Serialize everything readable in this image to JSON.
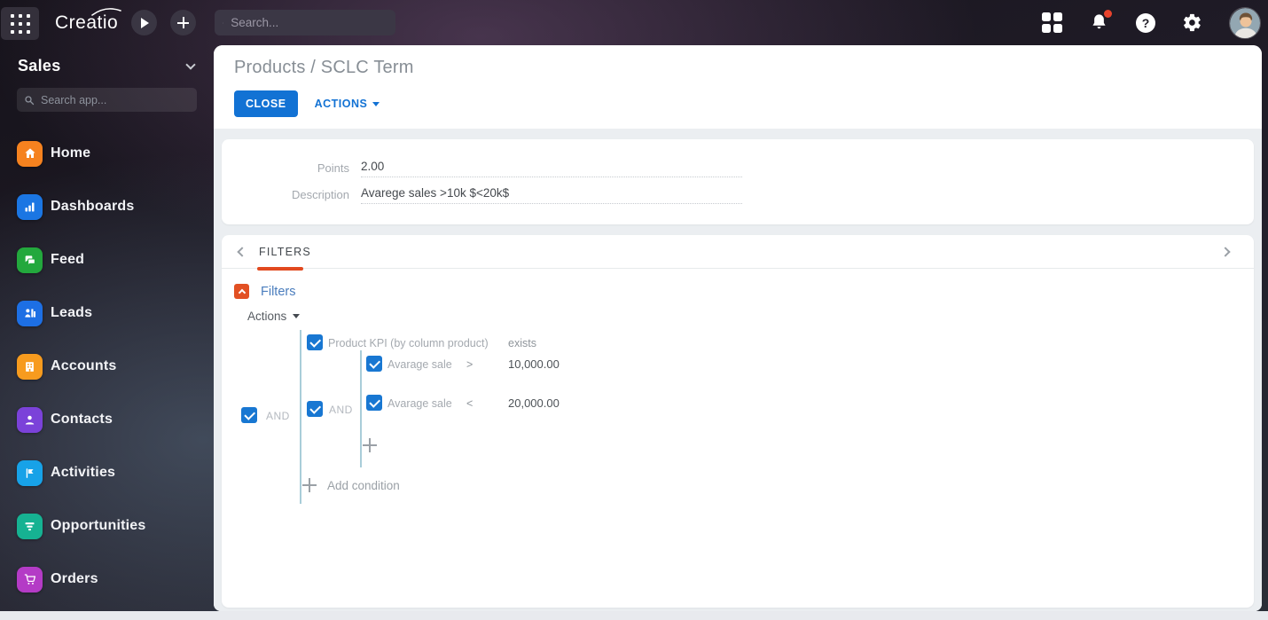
{
  "topbar": {
    "logo": "Creatio",
    "search_placeholder": "Search..."
  },
  "sidebar": {
    "workspace": "Sales",
    "search_placeholder": "Search app...",
    "items": [
      {
        "label": "Home",
        "icon": "home-icon",
        "color": "#f5821f"
      },
      {
        "label": "Dashboards",
        "icon": "bar-chart-icon",
        "color": "#1b76e3"
      },
      {
        "label": "Feed",
        "icon": "chat-bubbles-icon",
        "color": "#23a83d"
      },
      {
        "label": "Leads",
        "icon": "leads-icon",
        "color": "#1d6fe4"
      },
      {
        "label": "Accounts",
        "icon": "building-icon",
        "color": "#f79b1e"
      },
      {
        "label": "Contacts",
        "icon": "person-icon",
        "color": "#7b42d9"
      },
      {
        "label": "Activities",
        "icon": "flag-icon",
        "color": "#17a2e8"
      },
      {
        "label": "Opportunities",
        "icon": "funnel-icon",
        "color": "#16b292"
      },
      {
        "label": "Orders",
        "icon": "cart-icon",
        "color": "#b43bc6"
      }
    ]
  },
  "page": {
    "title": "Products / SCLC Term",
    "close_label": "CLOSE",
    "actions_label": "ACTIONS"
  },
  "record": {
    "points_label": "Points",
    "points_value": "2.00",
    "description_label": "Description",
    "description_value": "Avarege sales >10k $<20k$"
  },
  "filters": {
    "tab_label": "FILTERS",
    "section_label": "Filters",
    "actions_label": "Actions",
    "outer_operator": "AND",
    "inner_operator": "AND",
    "group_header": "Product KPI (by column product)",
    "group_comparison": "exists",
    "conditions": [
      {
        "field": "Avarage sale",
        "operator": ">",
        "value": "10,000.00"
      },
      {
        "field": "Avarage sale",
        "operator": "<",
        "value": "20,000.00"
      }
    ],
    "add_condition_label": "Add condition"
  },
  "colors": {
    "accent_blue": "#1272d4",
    "tab_accent_orange": "#e2491f",
    "checkbox_blue": "#1877d2",
    "notification_red": "#e8432d"
  }
}
